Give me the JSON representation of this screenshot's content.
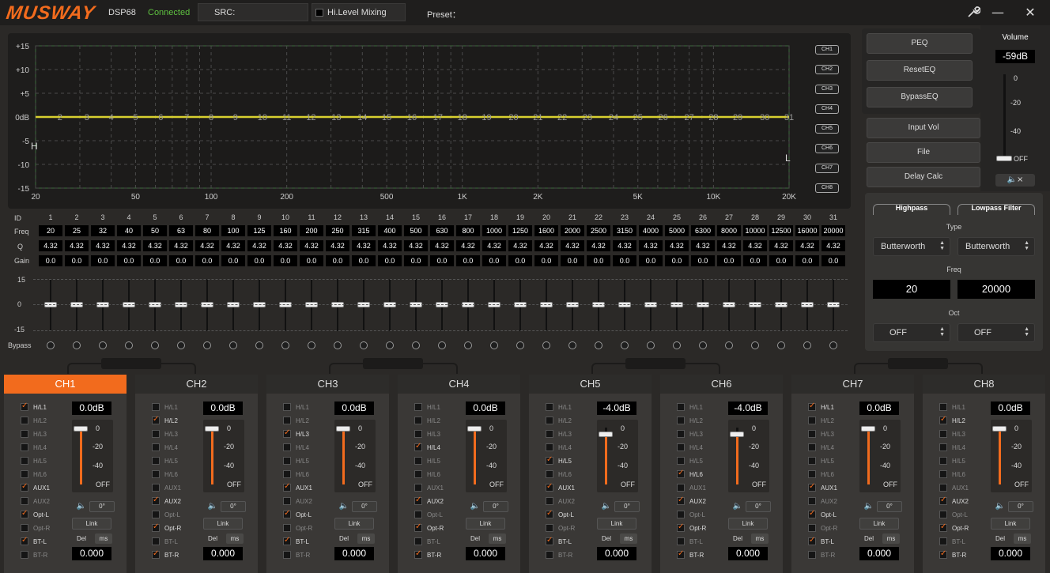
{
  "app": {
    "brand": "MUSWAY",
    "model": "DSP68",
    "status": "Connected",
    "src_label": "SRC:",
    "hi_level_label": "Hi.Level Mixing",
    "preset_label": "Preset："
  },
  "graph": {
    "y_labels": [
      "+15",
      "+10",
      "+5",
      "0dB",
      "-5",
      "-10",
      "-15"
    ],
    "x_labels": [
      "20",
      "50",
      "100",
      "200",
      "500",
      "1K",
      "2K",
      "5K",
      "10K",
      "20K"
    ],
    "marker_h": "H",
    "marker_l": "L",
    "ch_buttons": [
      "CH1",
      "CH2",
      "CH3",
      "CH4",
      "CH5",
      "CH6",
      "CH7",
      "CH8"
    ]
  },
  "controls": {
    "peq": "PEQ",
    "reset": "ResetEQ",
    "bypass": "BypassEQ",
    "input_vol": "Input Vol",
    "file": "File",
    "delay_calc": "Delay Calc"
  },
  "volume": {
    "title": "Volume",
    "value": "-59dB",
    "scale": [
      "0",
      "-20",
      "-40",
      "OFF"
    ],
    "mute_icon": "speaker-mute-icon"
  },
  "filters": {
    "highpass": "Highpass",
    "lowpass": "Lowpass Filter",
    "type_label": "Type",
    "hp_type": "Butterworth",
    "lp_type": "Butterworth",
    "freq_label": "Freq",
    "hp_freq": "20",
    "lp_freq": "20000",
    "oct_label": "Oct",
    "hp_oct": "OFF",
    "lp_oct": "OFF"
  },
  "eq": {
    "row_labels": {
      "id": "ID",
      "freq": "Freq",
      "q": "Q",
      "gain": "Gain",
      "bypass": "Bypass"
    },
    "fader_scale": [
      "15",
      "0",
      "-15"
    ],
    "ids": [
      "1",
      "2",
      "3",
      "4",
      "5",
      "6",
      "7",
      "8",
      "9",
      "10",
      "11",
      "12",
      "13",
      "14",
      "15",
      "16",
      "17",
      "18",
      "19",
      "20",
      "21",
      "22",
      "23",
      "24",
      "25",
      "26",
      "27",
      "28",
      "29",
      "30",
      "31"
    ],
    "freqs": [
      "20",
      "25",
      "32",
      "40",
      "50",
      "63",
      "80",
      "100",
      "125",
      "160",
      "200",
      "250",
      "315",
      "400",
      "500",
      "630",
      "800",
      "1000",
      "1250",
      "1600",
      "2000",
      "2500",
      "3150",
      "4000",
      "5000",
      "6300",
      "8000",
      "10000",
      "12500",
      "16000",
      "20000"
    ],
    "q": "4.32",
    "gain": "0.0"
  },
  "input_labels": [
    "H/L1",
    "H/L2",
    "H/L3",
    "H/L4",
    "H/L5",
    "H/L6",
    "AUX1",
    "AUX2",
    "Opt-L",
    "Opt-R",
    "BT-L",
    "BT-R"
  ],
  "channels": [
    {
      "name": "CH1",
      "active": true,
      "gain": "0.0dB",
      "level": 1.0,
      "phase": "0°",
      "link": "Link",
      "del": "Del",
      "ms": "ms",
      "delay": "0.000",
      "checks": [
        1,
        0,
        0,
        0,
        0,
        0,
        1,
        0,
        1,
        0,
        1,
        0
      ]
    },
    {
      "name": "CH2",
      "active": false,
      "gain": "0.0dB",
      "level": 1.0,
      "phase": "0°",
      "link": "Link",
      "del": "Del",
      "ms": "ms",
      "delay": "0.000",
      "checks": [
        0,
        1,
        0,
        0,
        0,
        0,
        0,
        1,
        0,
        1,
        0,
        1
      ]
    },
    {
      "name": "CH3",
      "active": false,
      "gain": "0.0dB",
      "level": 1.0,
      "phase": "0°",
      "link": "Link",
      "del": "Del",
      "ms": "ms",
      "delay": "0.000",
      "checks": [
        0,
        0,
        1,
        0,
        0,
        0,
        1,
        0,
        1,
        0,
        1,
        0
      ]
    },
    {
      "name": "CH4",
      "active": false,
      "gain": "0.0dB",
      "level": 1.0,
      "phase": "0°",
      "link": "Link",
      "del": "Del",
      "ms": "ms",
      "delay": "0.000",
      "checks": [
        0,
        0,
        0,
        1,
        0,
        0,
        0,
        1,
        0,
        1,
        0,
        1
      ]
    },
    {
      "name": "CH5",
      "active": false,
      "gain": "-4.0dB",
      "level": 0.9,
      "phase": "0°",
      "link": "Link",
      "del": "Del",
      "ms": "ms",
      "delay": "0.000",
      "checks": [
        0,
        0,
        0,
        0,
        1,
        0,
        1,
        0,
        1,
        0,
        1,
        0
      ]
    },
    {
      "name": "CH6",
      "active": false,
      "gain": "-4.0dB",
      "level": 0.9,
      "phase": "0°",
      "link": "Link",
      "del": "Del",
      "ms": "ms",
      "delay": "0.000",
      "checks": [
        0,
        0,
        0,
        0,
        0,
        1,
        0,
        1,
        0,
        1,
        0,
        1
      ]
    },
    {
      "name": "CH7",
      "active": false,
      "gain": "0.0dB",
      "level": 1.0,
      "phase": "0°",
      "link": "Link",
      "del": "Del",
      "ms": "ms",
      "delay": "0.000",
      "checks": [
        1,
        0,
        0,
        0,
        0,
        0,
        1,
        0,
        1,
        0,
        1,
        0
      ]
    },
    {
      "name": "CH8",
      "active": false,
      "gain": "0.0dB",
      "level": 1.0,
      "phase": "0°",
      "link": "Link",
      "del": "Del",
      "ms": "ms",
      "delay": "0.000",
      "checks": [
        0,
        1,
        0,
        0,
        0,
        0,
        0,
        1,
        0,
        1,
        0,
        1
      ]
    }
  ],
  "strip_scale": [
    "0",
    "-20",
    "-40",
    "OFF"
  ],
  "colors": {
    "accent": "#f26b1d",
    "curve": "#d8d030",
    "grid": "#555555",
    "status": "#5ec040"
  }
}
